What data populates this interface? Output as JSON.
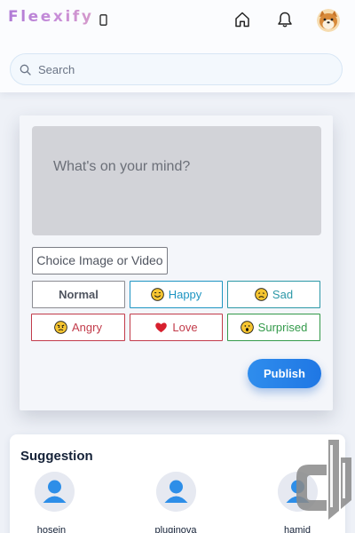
{
  "header": {
    "logo": "Fleexify",
    "icons": [
      "phone-icon",
      "home-icon",
      "bell-icon"
    ],
    "avatar": "shiba-avatar"
  },
  "search": {
    "placeholder": "Search"
  },
  "composer": {
    "placeholder": "What's on your mind?",
    "choose_label": "Choice Image or Video",
    "moods": [
      {
        "label": "Normal"
      },
      {
        "label": "Happy",
        "emoji": "😊"
      },
      {
        "label": "Sad",
        "emoji": "😞"
      },
      {
        "label": "Angry",
        "emoji": "😠"
      },
      {
        "label": "Love",
        "emoji": "❤️"
      },
      {
        "label": "Surprised",
        "emoji": "😮"
      }
    ],
    "publish_label": "Publish"
  },
  "suggestion": {
    "title": "Suggestion",
    "users": [
      {
        "name": "hosein_"
      },
      {
        "name": "pluginova"
      },
      {
        "name": "hamid"
      }
    ]
  },
  "colors": {
    "accent": "#1f77e4",
    "happy": "#1e95c2",
    "sad": "#2c98a7",
    "angry": "#c23b4a",
    "love": "#c23b4a",
    "surprised": "#339a4a"
  }
}
